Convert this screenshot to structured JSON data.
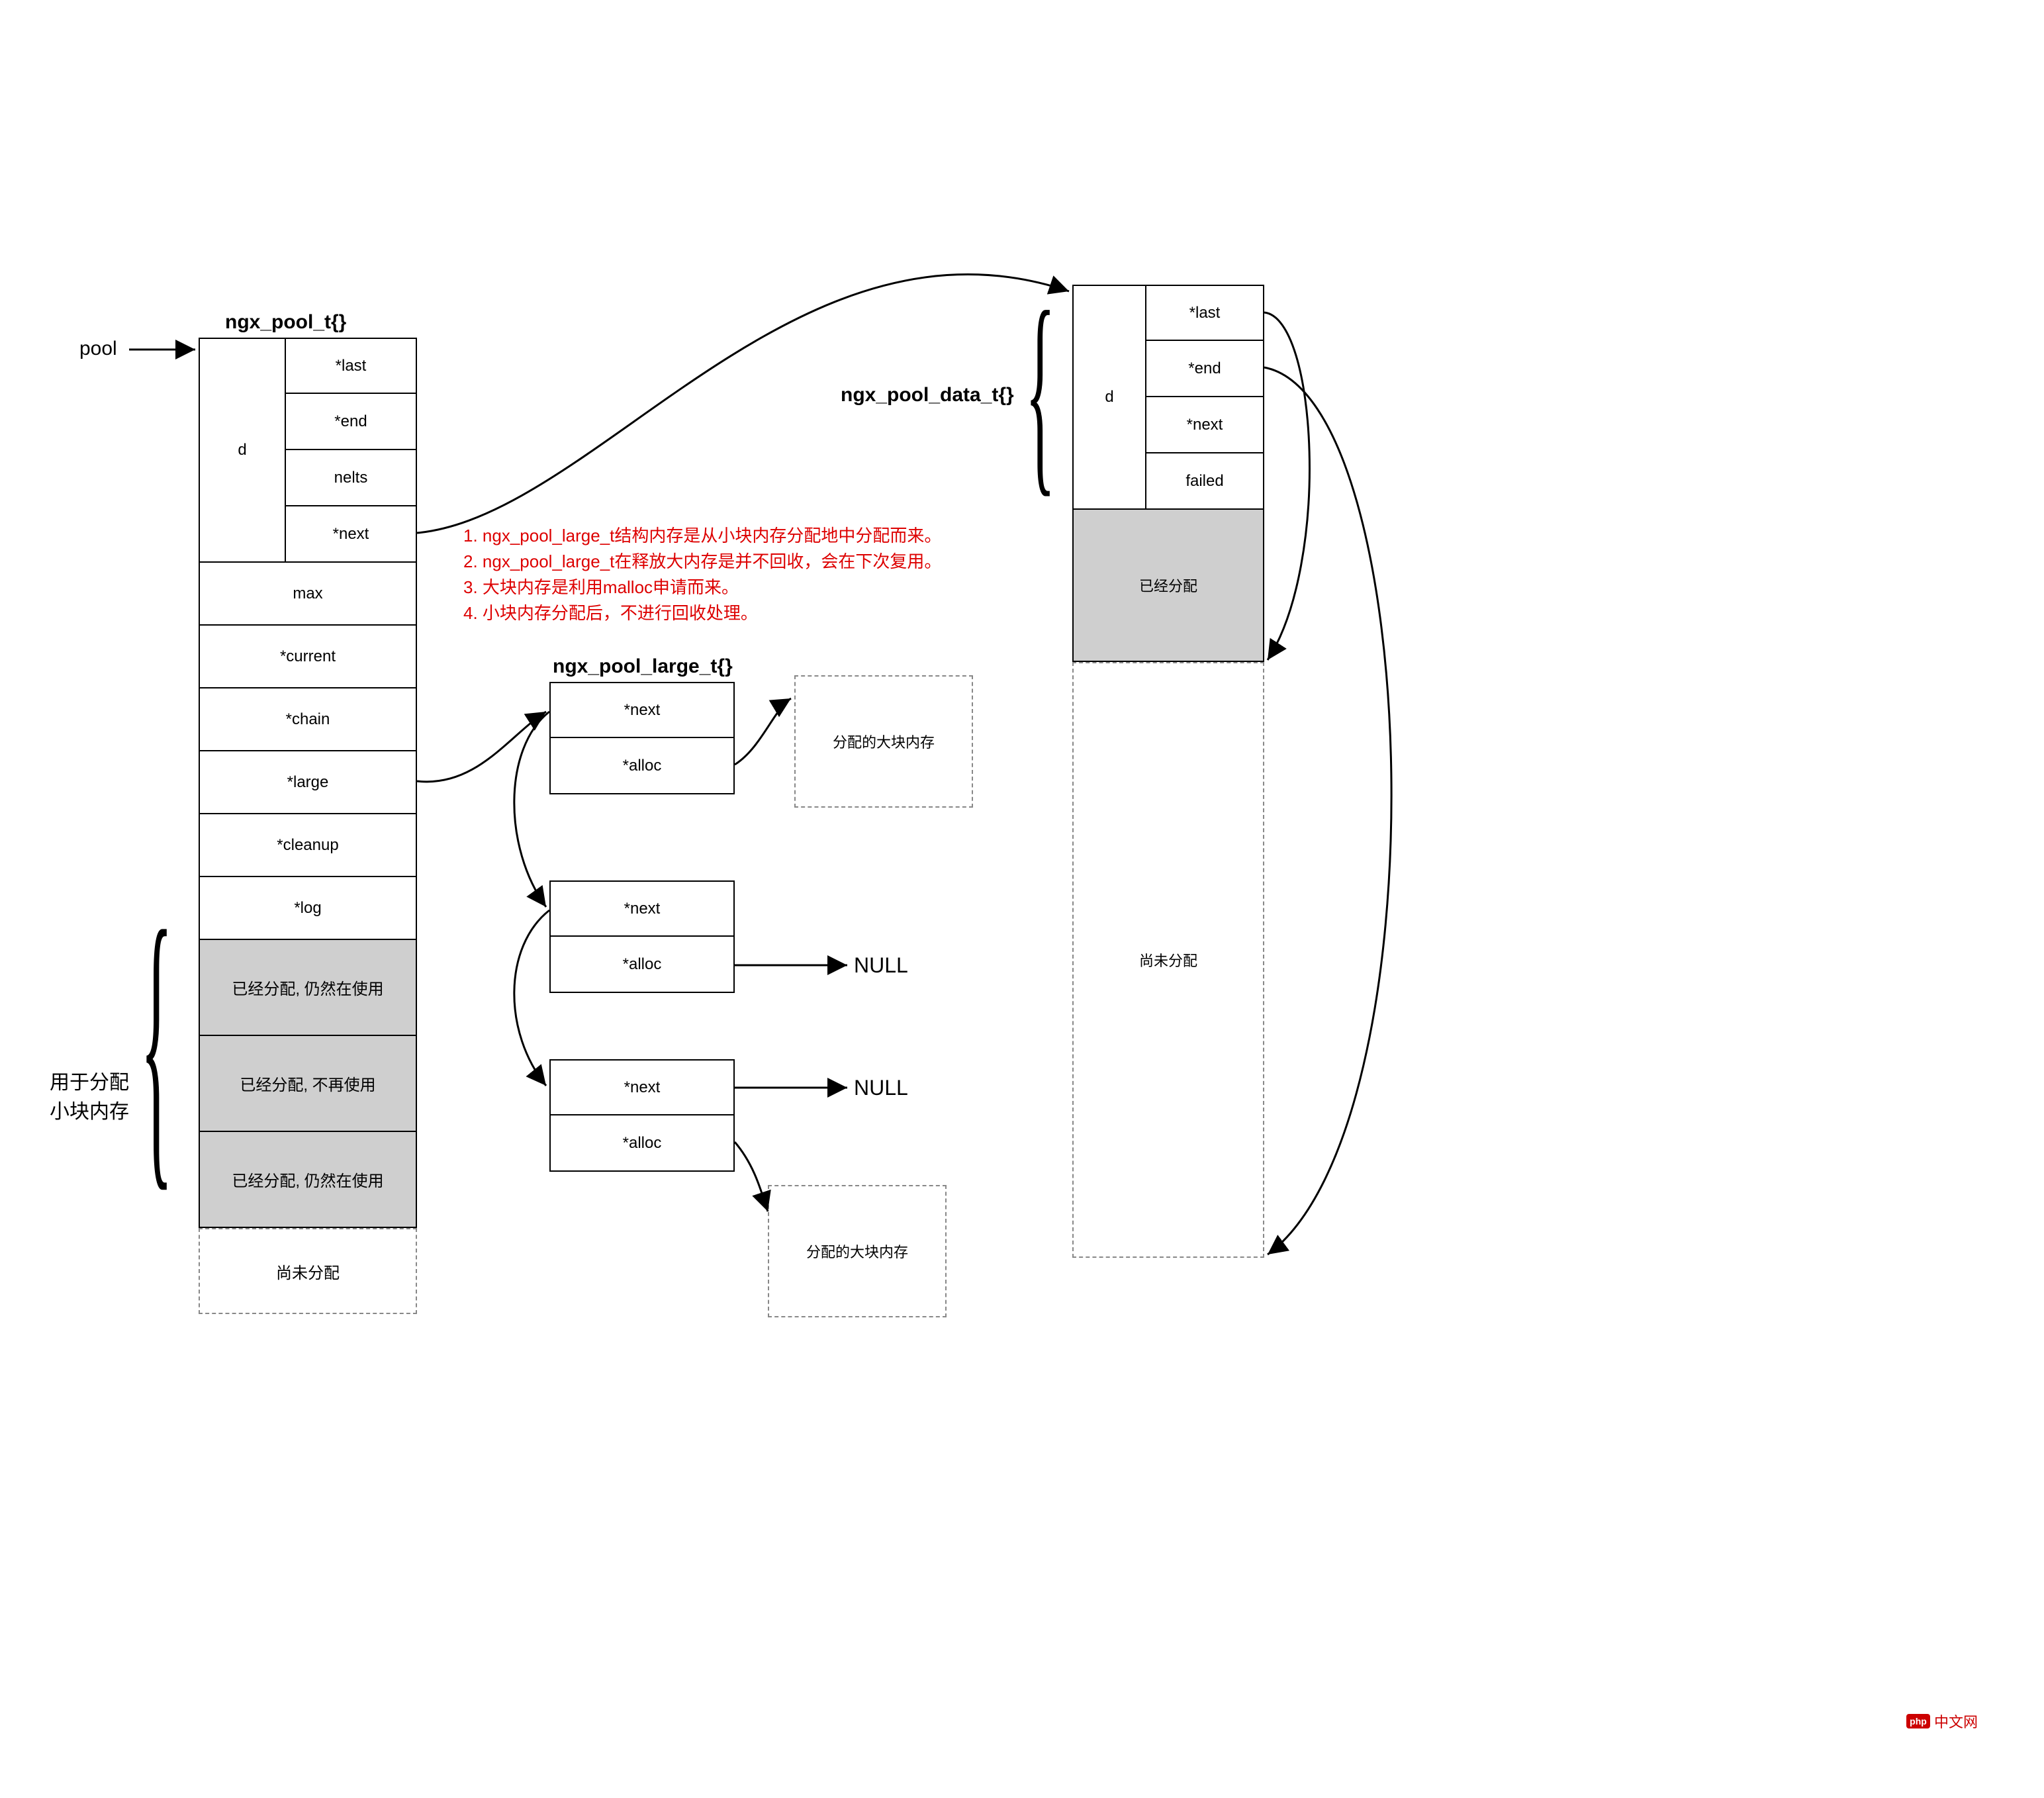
{
  "labels": {
    "pool": "pool",
    "ngx_pool_t": "ngx_pool_t{}",
    "ngx_pool_data_t": "ngx_pool_data_t{}",
    "ngx_pool_large_t": "ngx_pool_large_t{}",
    "small_mem": "用于分配\n小块内存",
    "null1": "NULL",
    "null2": "NULL",
    "logo_text": "中文网",
    "logo_badge": "php"
  },
  "pool_t_fields": {
    "d": "d",
    "last": "*last",
    "end": "*end",
    "nelts": "nelts",
    "next": "*next",
    "max": "max",
    "current": "*current",
    "chain": "*chain",
    "large": "*large",
    "cleanup": "*cleanup",
    "log": "*log"
  },
  "data_t_fields": {
    "d": "d",
    "last": "*last",
    "end": "*end",
    "next": "*next",
    "failed": "failed"
  },
  "large_t_fields": {
    "next": "*next",
    "alloc": "*alloc"
  },
  "memory_blocks": {
    "allocated_inuse": "已经分配, 仍然在使用",
    "allocated_unused": "已经分配, 不再使用",
    "not_allocated": "尚未分配",
    "allocated": "已经分配",
    "large_allocated": "分配的大块内存"
  },
  "notes": [
    "1. ngx_pool_large_t结构内存是从小块内存分配地中分配而来。",
    "2. ngx_pool_large_t在释放大内存是并不回收，会在下次复用。",
    "3. 大块内存是利用malloc申请而来。",
    "4. 小块内存分配后，不进行回收处理。"
  ]
}
